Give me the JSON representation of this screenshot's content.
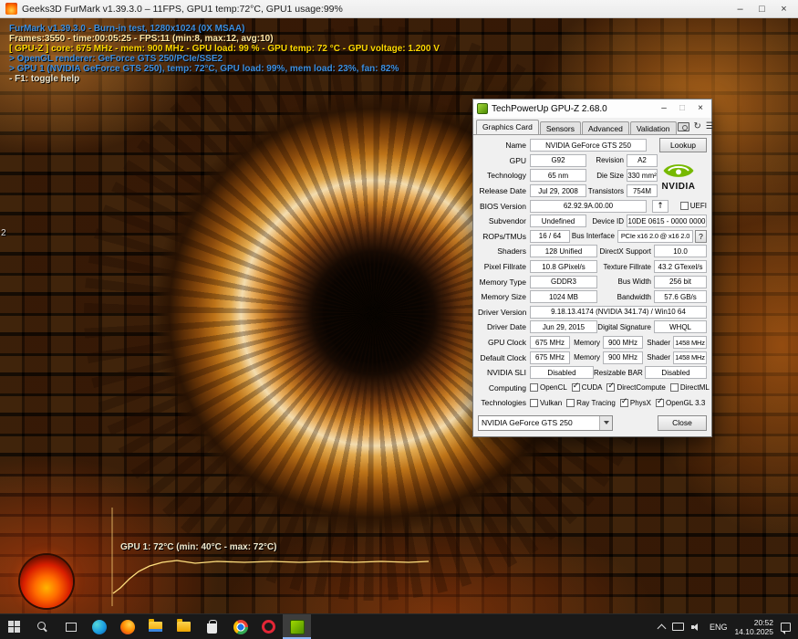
{
  "window_controls": {
    "minimize": "–",
    "maximize": "□",
    "close": "×"
  },
  "furmark": {
    "window_title": "Geeks3D FurMark v1.39.3.0 – 11FPS, GPU1 temp:72°C, GPU1 usage:99%",
    "osd": {
      "line1": "FurMark v1.39.3.0 - Burn-in test, 1280x1024 (0X MSAA)",
      "line2": "Frames:3550 - time:00:05:25 - FPS:11 (min:8, max:12, avg:10)",
      "line3": "[ GPU-Z ] core: 675 MHz - mem: 900 MHz - GPU load: 99 % - GPU temp: 72 °C - GPU voltage: 1.200 V",
      "line4": "> OpenGL renderer: GeForce GTS 250/PCIe/SSE2",
      "line5": "> GPU 1 (NVIDIA GeForce GTS 250), temp: 72°C, GPU load: 99%, mem load: 23%, fan: 82%",
      "line6": "- F1: toggle help"
    },
    "temp_graph_label": "GPU 1: 72°C (min: 40°C - max: 72°C)",
    "left_edge_label": "2"
  },
  "gpuz": {
    "title": "TechPowerUp GPU-Z 2.68.0",
    "tabs": {
      "graphics_card": "Graphics Card",
      "sensors": "Sensors",
      "advanced": "Advanced",
      "validation": "Validation"
    },
    "toolbar": {
      "refresh": "↻",
      "menu": "☰",
      "upload": "↑"
    },
    "lookup_button": "Lookup",
    "bus_help_button": "?",
    "nvidia_logo_text": "NVIDIA",
    "card_selector": "NVIDIA GeForce GTS 250",
    "close_button": "Close",
    "fields": {
      "name": {
        "label": "Name",
        "value": "NVIDIA GeForce GTS 250"
      },
      "gpu": {
        "label": "GPU",
        "value": "G92"
      },
      "revision": {
        "label": "Revision",
        "value": "A2"
      },
      "technology": {
        "label": "Technology",
        "value": "65 nm"
      },
      "die_size": {
        "label": "Die Size",
        "value": "330 mm²"
      },
      "release_date": {
        "label": "Release Date",
        "value": "Jul 29, 2008"
      },
      "transistors": {
        "label": "Transistors",
        "value": "754M"
      },
      "bios_version": {
        "label": "BIOS Version",
        "value": "62.92.9A.00.00"
      },
      "uefi": {
        "label": "UEFI",
        "checked": false
      },
      "subvendor": {
        "label": "Subvendor",
        "value": "Undefined"
      },
      "device_id": {
        "label": "Device ID",
        "value": "10DE 0615 - 0000 0000"
      },
      "rops_tmus": {
        "label": "ROPs/TMUs",
        "value": "16 / 64"
      },
      "bus_interface": {
        "label": "Bus Interface",
        "value": "PCIe x16 2.0 @ x16 2.0"
      },
      "shaders": {
        "label": "Shaders",
        "value": "128 Unified"
      },
      "directx_support": {
        "label": "DirectX Support",
        "value": "10.0"
      },
      "pixel_fillrate": {
        "label": "Pixel Fillrate",
        "value": "10.8 GPixel/s"
      },
      "texture_fillrate": {
        "label": "Texture Fillrate",
        "value": "43.2 GTexel/s"
      },
      "memory_type": {
        "label": "Memory Type",
        "value": "GDDR3"
      },
      "bus_width": {
        "label": "Bus Width",
        "value": "256 bit"
      },
      "memory_size": {
        "label": "Memory Size",
        "value": "1024 MB"
      },
      "bandwidth": {
        "label": "Bandwidth",
        "value": "57.6 GB/s"
      },
      "driver_version": {
        "label": "Driver Version",
        "value": "9.18.13.4174 (NVIDIA 341.74) / Win10 64"
      },
      "driver_date": {
        "label": "Driver Date",
        "value": "Jun 29, 2015"
      },
      "digital_signature": {
        "label": "Digital Signature",
        "value": "WHQL"
      },
      "gpu_clock": {
        "label": "GPU Clock",
        "value": "675 MHz"
      },
      "gpu_clock_memory": {
        "label": "Memory",
        "value": "900 MHz"
      },
      "gpu_clock_shader": {
        "label": "Shader",
        "value": "1458 MHz"
      },
      "default_clock": {
        "label": "Default Clock",
        "value": "675 MHz"
      },
      "default_clock_memory": {
        "label": "Memory",
        "value": "900 MHz"
      },
      "default_clock_shader": {
        "label": "Shader",
        "value": "1458 MHz"
      },
      "nvidia_sli": {
        "label": "NVIDIA SLI",
        "value": "Disabled"
      },
      "resizable_bar": {
        "label": "Resizable BAR",
        "value": "Disabled"
      },
      "computing": {
        "label": "Computing"
      },
      "opencl": {
        "label": "OpenCL",
        "checked": false
      },
      "cuda": {
        "label": "CUDA",
        "checked": true
      },
      "directcompute": {
        "label": "DirectCompute",
        "checked": true
      },
      "directml": {
        "label": "DirectML",
        "checked": false
      },
      "technologies": {
        "label": "Technologies"
      },
      "vulkan": {
        "label": "Vulkan",
        "checked": false
      },
      "ray_tracing": {
        "label": "Ray Tracing",
        "checked": false
      },
      "physx": {
        "label": "PhysX",
        "checked": true
      },
      "opengl": {
        "label": "OpenGL 3.3",
        "checked": true
      }
    }
  },
  "taskbar": {
    "apps": [
      "start",
      "search",
      "task-view",
      "edge",
      "firefox",
      "file-explorer",
      "folder",
      "store",
      "chrome",
      "opera",
      "gpu-z"
    ],
    "tray": {
      "language": "ENG",
      "time": "20:52",
      "date": "14.10.2025"
    }
  }
}
